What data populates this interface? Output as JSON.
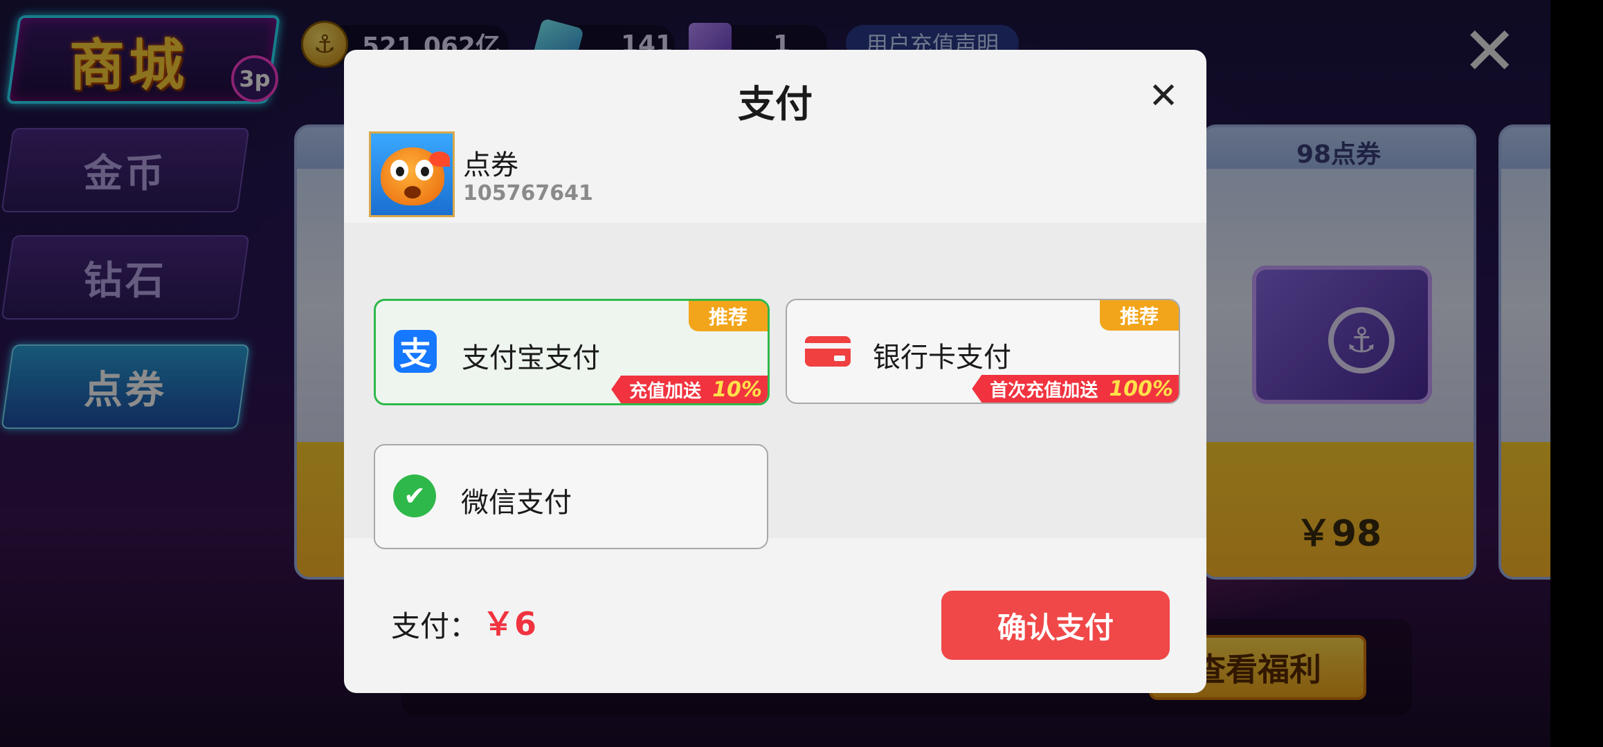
{
  "scene": {
    "shop_title": "商城",
    "logo_badge": "3p",
    "resources": {
      "coins": "521,062亿",
      "diamonds": "141",
      "tickets": "1"
    },
    "notice_label": "用户充值声明",
    "close_glyph": "✕",
    "nav_tabs": [
      {
        "label": "金币",
        "active": false
      },
      {
        "label": "钻石",
        "active": false
      },
      {
        "label": "点券",
        "active": true
      }
    ],
    "card": {
      "title": "98点券",
      "price": "￥98"
    },
    "benefit_button": "查看福利"
  },
  "modal": {
    "title": "支付",
    "close_glyph": "✕",
    "product": {
      "name": "点券",
      "id": "105767641"
    },
    "methods": [
      {
        "label": "支付宝支付",
        "icon": "alipay-icon",
        "icon_glyph": "支",
        "badge": "推荐",
        "bonus_text": "充值加送",
        "bonus_pct": "10%",
        "selected": true
      },
      {
        "label": "银行卡支付",
        "icon": "bank-card-icon",
        "badge": "推荐",
        "bonus_text": "首次充值加送",
        "bonus_pct": "100%",
        "selected": false
      },
      {
        "label": "微信支付",
        "icon": "wechat-icon",
        "icon_glyph": "✔",
        "selected": false
      }
    ],
    "footer": {
      "pay_label": "支付：",
      "amount": "￥6",
      "confirm_label": "确认支付"
    }
  },
  "colors": {
    "confirm": "#f04848",
    "amount": "#f0333f",
    "badge": "#f2a51a",
    "selected_border": "#2fb84a",
    "alipay": "#1677ff"
  }
}
